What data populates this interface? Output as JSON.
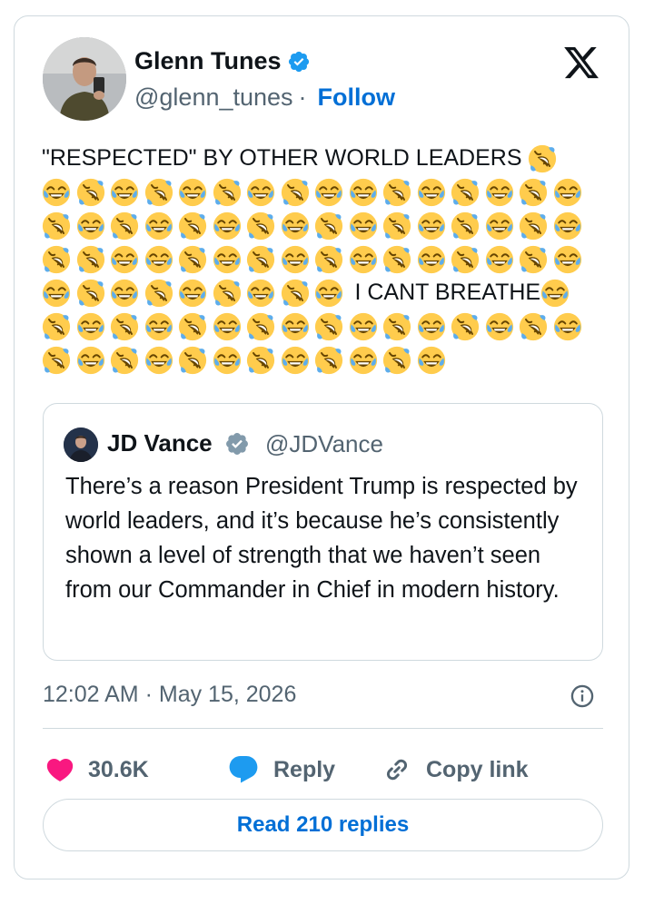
{
  "author": {
    "name": "Glenn Tunes",
    "handle": "@glenn_tunes",
    "separator": "·",
    "follow_label": "Follow"
  },
  "tweet": {
    "lines": [
      {
        "segments": [
          {
            "t": "text",
            "v": "\"RESPECTED\" BY OTHER WORLD LEADERS "
          },
          {
            "t": "emoji",
            "e": "rofl"
          }
        ]
      },
      {
        "segments": [
          {
            "t": "emoji",
            "e": "joy"
          },
          {
            "t": "emoji",
            "e": "rofl"
          },
          {
            "t": "emoji",
            "e": "joy"
          },
          {
            "t": "emoji",
            "e": "rofl"
          },
          {
            "t": "emoji",
            "e": "joy"
          },
          {
            "t": "emoji",
            "e": "rofl"
          },
          {
            "t": "emoji",
            "e": "joy"
          },
          {
            "t": "emoji",
            "e": "rofl"
          },
          {
            "t": "emoji",
            "e": "joy"
          },
          {
            "t": "emoji",
            "e": "joy"
          },
          {
            "t": "emoji",
            "e": "rofl"
          },
          {
            "t": "emoji",
            "e": "joy"
          },
          {
            "t": "emoji",
            "e": "rofl"
          },
          {
            "t": "emoji",
            "e": "joy"
          },
          {
            "t": "emoji",
            "e": "rofl"
          },
          {
            "t": "emoji",
            "e": "joy"
          }
        ]
      },
      {
        "segments": [
          {
            "t": "emoji",
            "e": "rofl"
          },
          {
            "t": "emoji",
            "e": "joy"
          },
          {
            "t": "emoji",
            "e": "rofl"
          },
          {
            "t": "emoji",
            "e": "joy"
          },
          {
            "t": "emoji",
            "e": "rofl"
          },
          {
            "t": "emoji",
            "e": "joy"
          },
          {
            "t": "emoji",
            "e": "rofl"
          },
          {
            "t": "emoji",
            "e": "joy"
          },
          {
            "t": "emoji",
            "e": "rofl"
          },
          {
            "t": "emoji",
            "e": "joy"
          },
          {
            "t": "emoji",
            "e": "rofl"
          },
          {
            "t": "emoji",
            "e": "joy"
          },
          {
            "t": "emoji",
            "e": "rofl"
          },
          {
            "t": "emoji",
            "e": "joy"
          },
          {
            "t": "emoji",
            "e": "rofl"
          },
          {
            "t": "emoji",
            "e": "joy"
          }
        ]
      },
      {
        "segments": [
          {
            "t": "emoji",
            "e": "rofl"
          },
          {
            "t": "emoji",
            "e": "rofl"
          },
          {
            "t": "emoji",
            "e": "joy"
          },
          {
            "t": "emoji",
            "e": "joy"
          },
          {
            "t": "emoji",
            "e": "rofl"
          },
          {
            "t": "emoji",
            "e": "joy"
          },
          {
            "t": "emoji",
            "e": "rofl"
          },
          {
            "t": "emoji",
            "e": "joy"
          },
          {
            "t": "emoji",
            "e": "rofl"
          },
          {
            "t": "emoji",
            "e": "joy"
          },
          {
            "t": "emoji",
            "e": "rofl"
          },
          {
            "t": "emoji",
            "e": "joy"
          },
          {
            "t": "emoji",
            "e": "rofl"
          },
          {
            "t": "emoji",
            "e": "joy"
          },
          {
            "t": "emoji",
            "e": "rofl"
          },
          {
            "t": "emoji",
            "e": "joy"
          }
        ]
      },
      {
        "segments": [
          {
            "t": "emoji",
            "e": "joy"
          },
          {
            "t": "emoji",
            "e": "rofl"
          },
          {
            "t": "emoji",
            "e": "joy"
          },
          {
            "t": "emoji",
            "e": "rofl"
          },
          {
            "t": "emoji",
            "e": "joy"
          },
          {
            "t": "emoji",
            "e": "rofl"
          },
          {
            "t": "emoji",
            "e": "joy"
          },
          {
            "t": "emoji",
            "e": "rofl"
          },
          {
            "t": "emoji",
            "e": "joy"
          },
          {
            "t": "text",
            "v": " I CANT BREATHE"
          },
          {
            "t": "emoji",
            "e": "joy"
          }
        ]
      },
      {
        "segments": [
          {
            "t": "emoji",
            "e": "rofl"
          },
          {
            "t": "emoji",
            "e": "joy"
          },
          {
            "t": "emoji",
            "e": "rofl"
          },
          {
            "t": "emoji",
            "e": "joy"
          },
          {
            "t": "emoji",
            "e": "rofl"
          },
          {
            "t": "emoji",
            "e": "joy"
          },
          {
            "t": "emoji",
            "e": "rofl"
          },
          {
            "t": "emoji",
            "e": "joy"
          },
          {
            "t": "emoji",
            "e": "rofl"
          },
          {
            "t": "emoji",
            "e": "joy"
          },
          {
            "t": "emoji",
            "e": "rofl"
          },
          {
            "t": "emoji",
            "e": "joy"
          },
          {
            "t": "emoji",
            "e": "rofl"
          },
          {
            "t": "emoji",
            "e": "joy"
          },
          {
            "t": "emoji",
            "e": "rofl"
          },
          {
            "t": "emoji",
            "e": "joy"
          }
        ]
      },
      {
        "segments": [
          {
            "t": "emoji",
            "e": "rofl"
          },
          {
            "t": "emoji",
            "e": "joy"
          },
          {
            "t": "emoji",
            "e": "rofl"
          },
          {
            "t": "emoji",
            "e": "joy"
          },
          {
            "t": "emoji",
            "e": "rofl"
          },
          {
            "t": "emoji",
            "e": "joy"
          },
          {
            "t": "emoji",
            "e": "rofl"
          },
          {
            "t": "emoji",
            "e": "joy"
          },
          {
            "t": "emoji",
            "e": "rofl"
          },
          {
            "t": "emoji",
            "e": "joy"
          },
          {
            "t": "emoji",
            "e": "rofl"
          },
          {
            "t": "emoji",
            "e": "joy"
          }
        ]
      }
    ]
  },
  "quote": {
    "name": "JD Vance",
    "handle": "@JDVance",
    "text": "There’s a reason President Trump is respected by world leaders, and it’s because he’s consistently shown a level of strength that we haven’t seen from our Commander in Chief in modern history."
  },
  "meta": {
    "time": "12:02 AM",
    "separator": "·",
    "date": "May 15, 2026"
  },
  "actions": {
    "likes": "30.6K",
    "reply_label": "Reply",
    "copy_link_label": "Copy link"
  },
  "read_replies_label": "Read 210 replies",
  "colors": {
    "accent": "#006fd6",
    "heart": "#f91880",
    "reply_bubble": "#1d9bf0",
    "secondary_text": "#536471",
    "border": "#cfd9de"
  }
}
